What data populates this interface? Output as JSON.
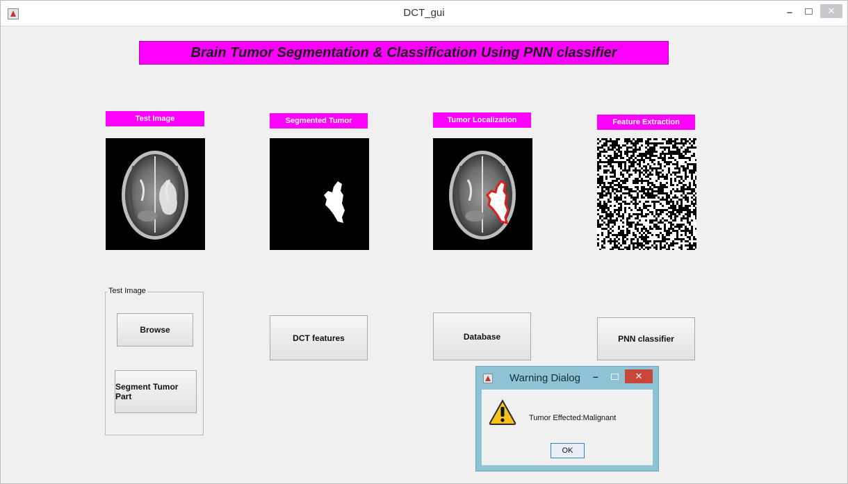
{
  "window": {
    "title": "DCT_gui"
  },
  "heading": "Brain Tumor Segmentation & Classification Using PNN classifier",
  "panels": [
    {
      "caption": "Test Image"
    },
    {
      "caption": "Segmented Tumor"
    },
    {
      "caption": "Tumor Localization"
    },
    {
      "caption": "Feature Extraction"
    }
  ],
  "group": {
    "title": "Test Image",
    "browse_label": "Browse",
    "segment_label": "Segment Tumor Part"
  },
  "buttons": {
    "dct_label": "DCT features",
    "database_label": "Database",
    "pnn_label": "PNN classifier"
  },
  "dialog": {
    "title": "Warning Dialog",
    "message": "Tumor Effected:Malignant",
    "ok_label": "OK"
  },
  "colors": {
    "accent": "#ff00ff",
    "window_bg": "#f0f0f0",
    "dialog_frame": "#8ec3d6",
    "tumor_outline": "#e01e1e"
  }
}
